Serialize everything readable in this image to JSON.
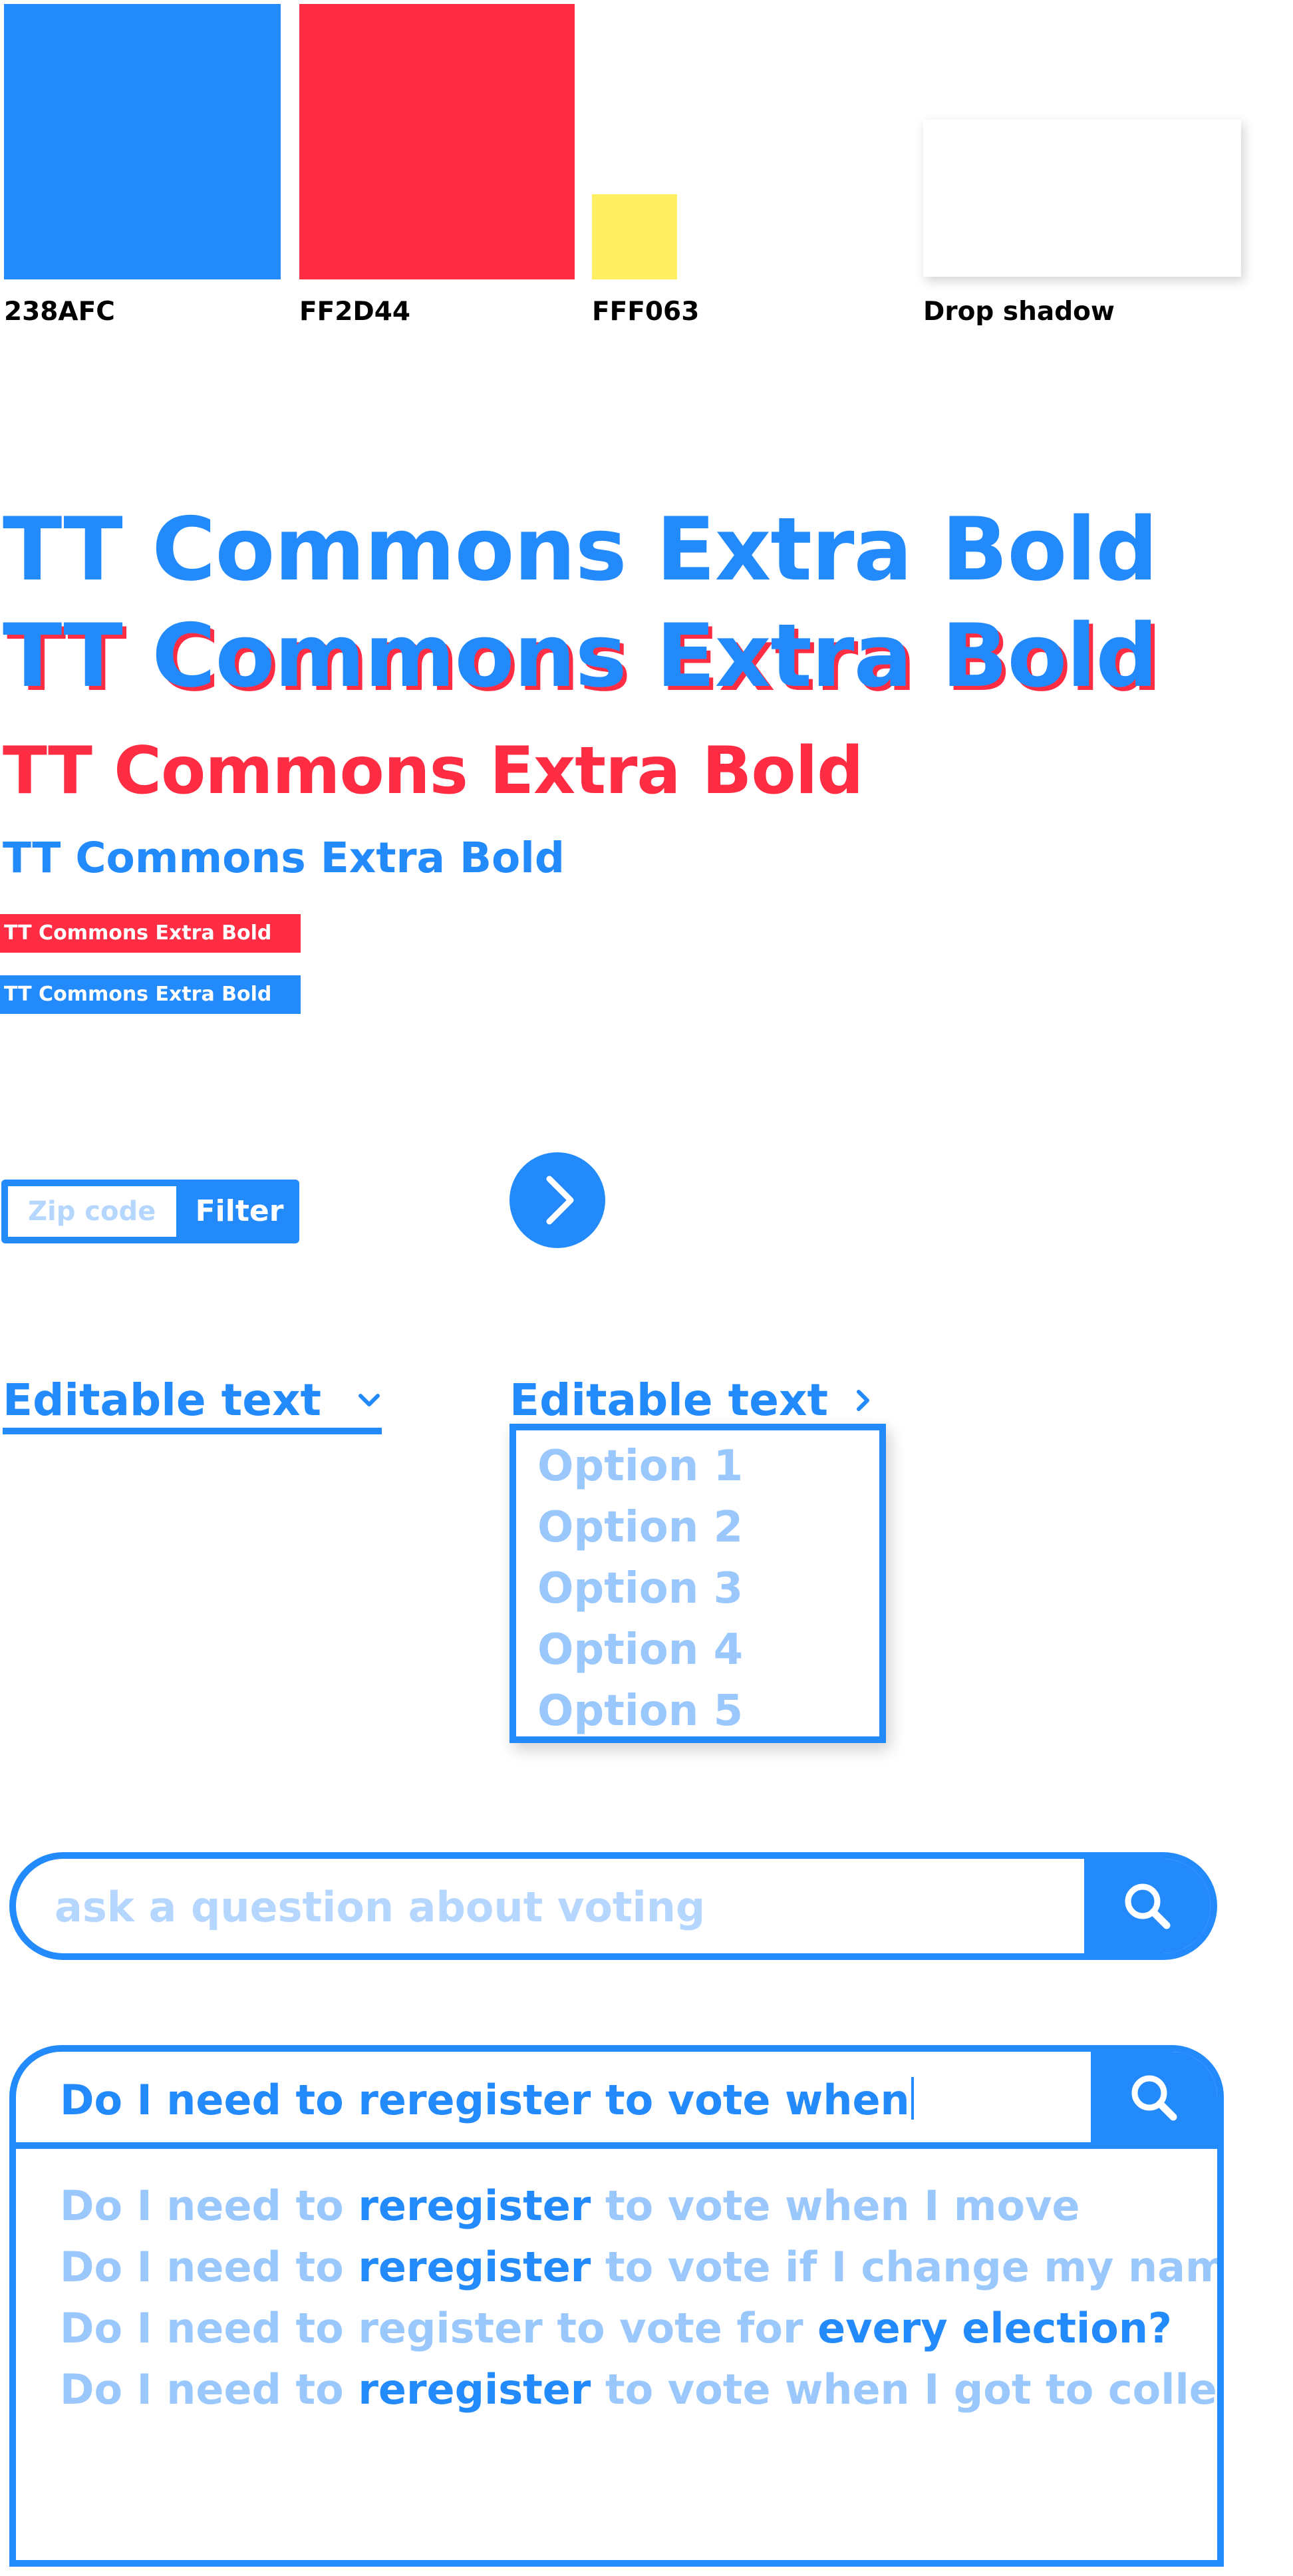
{
  "palette": {
    "swatches": [
      {
        "label": "238AFC",
        "color": "#238AFC"
      },
      {
        "label": "FF2D44",
        "color": "#FF2D44"
      },
      {
        "label": "FFF063",
        "color": "#FFF063"
      }
    ],
    "shadow_label": "Drop shadow"
  },
  "typography": {
    "xl": "TT Commons Extra Bold",
    "xl_shadow": "TT Commons Extra Bold",
    "lg": "TT Commons Extra Bold",
    "md": "TT Commons Extra Bold",
    "label_red": "TT Commons Extra Bold",
    "label_blue": "TT Commons Extra Bold"
  },
  "zip_filter": {
    "placeholder": "Zip code",
    "button_label": "Filter"
  },
  "next_button": {
    "icon": "chevron-right-icon"
  },
  "dropdown_closed": {
    "label": "Editable text",
    "icon": "chevron-down-icon"
  },
  "dropdown_open": {
    "label": "Editable text",
    "icon": "chevron-right-icon",
    "options": [
      "Option 1",
      "Option 2",
      "Option 3",
      "Option 4",
      "Option 5"
    ]
  },
  "search": {
    "placeholder": "ask a question about voting",
    "icon": "search-icon"
  },
  "search_suggest": {
    "value": "Do I need to reregister to vote when",
    "icon": "search-icon",
    "suggestions": [
      {
        "before": "Do I need to ",
        "highlight": "reregister",
        "after": " to vote when I move"
      },
      {
        "before": "Do I need to ",
        "highlight": "reregister",
        "after": " to vote if I change my name"
      },
      {
        "before": "Do I need to register to vote for ",
        "highlight": "every election?",
        "after": ""
      },
      {
        "before": "Do I need to ",
        "highlight": "reregister",
        "after": " to vote when I got to college?"
      }
    ]
  },
  "colors": {
    "blue": "#238AFC",
    "red": "#FF2D44",
    "yellow": "#FFF063",
    "light_blue": "#9BC8FC"
  }
}
